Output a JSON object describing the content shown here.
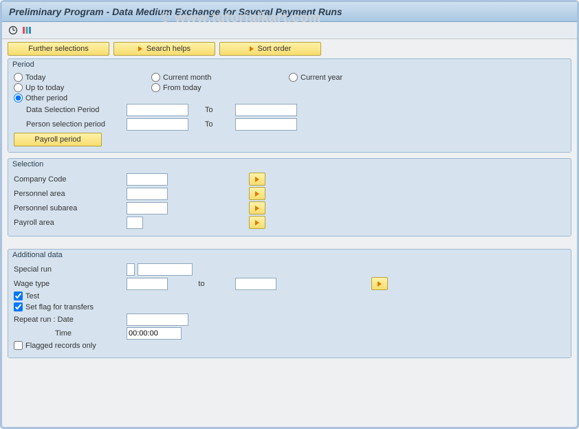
{
  "title": "Preliminary Program - Data Medium Exchange for Several Payment Runs",
  "watermark": "© www.tutorialkart.com",
  "topButtons": {
    "further": "Further selections",
    "search": "Search helps",
    "sort": "Sort order"
  },
  "period": {
    "legend": "Period",
    "today": "Today",
    "currentMonth": "Current month",
    "currentYear": "Current year",
    "upToToday": "Up to today",
    "fromToday": "From today",
    "otherPeriod": "Other period",
    "dataSel": "Data Selection Period",
    "personSel": "Person selection period",
    "to": "To",
    "payrollPeriodBtn": "Payroll period"
  },
  "selection": {
    "legend": "Selection",
    "companyCode": "Company Code",
    "personnelArea": "Personnel area",
    "personnelSubarea": "Personnel subarea",
    "payrollArea": "Payroll area"
  },
  "additional": {
    "legend": "Additional data",
    "specialRun": "Special run",
    "wageType": "Wage type",
    "toLower": "to",
    "test": "Test",
    "setFlag": "Set flag for transfers",
    "repeatRun": "Repeat run      : Date",
    "time": "Time",
    "timeValue": "00:00:00",
    "flaggedOnly": "Flagged records only"
  }
}
